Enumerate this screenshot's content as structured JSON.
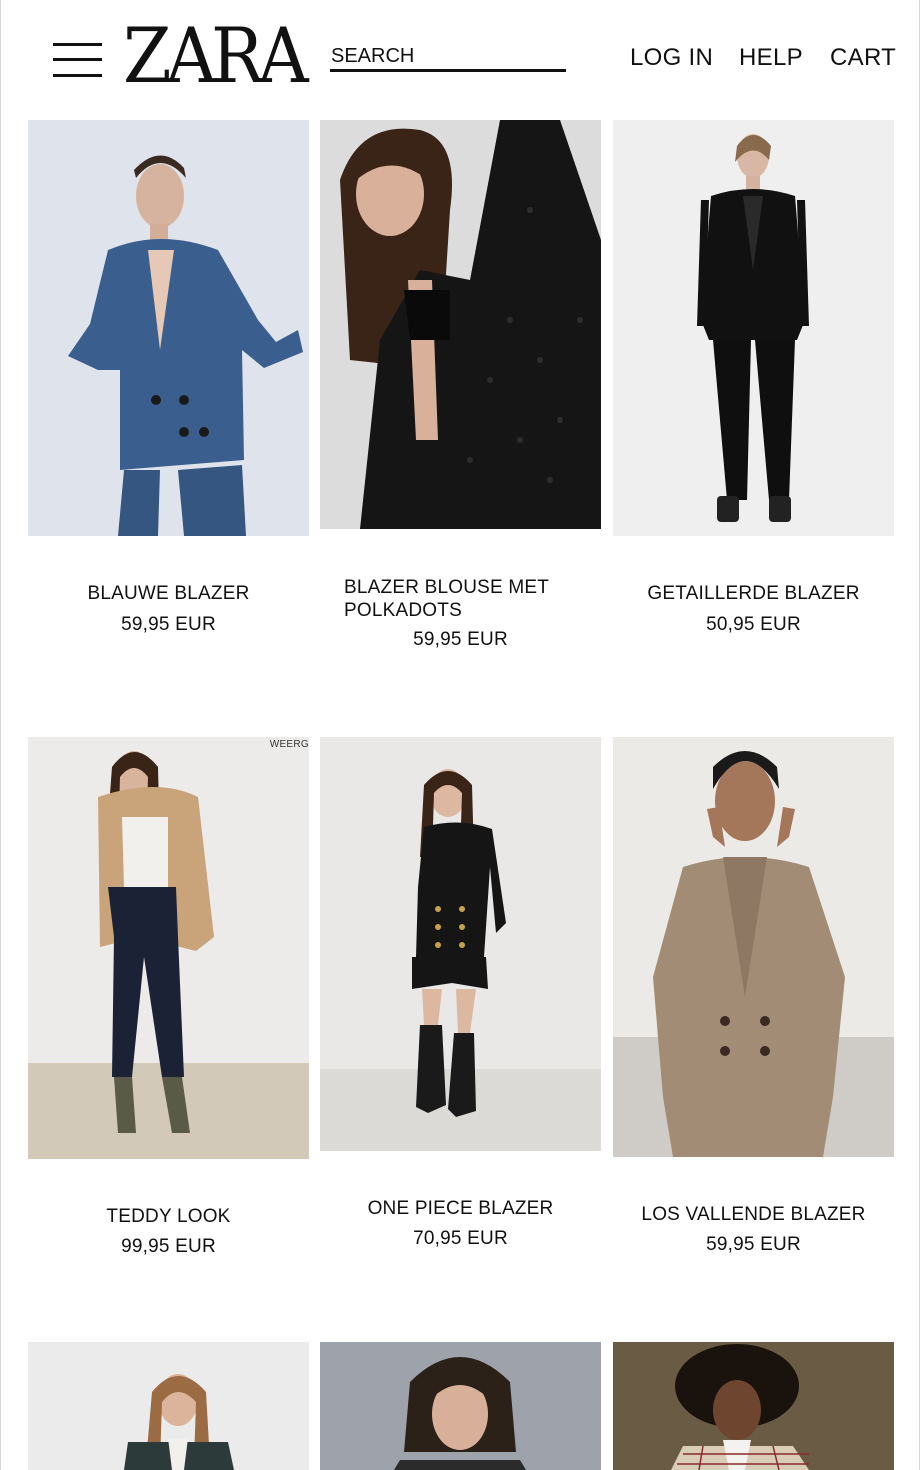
{
  "header": {
    "logo": "ZARA",
    "search_placeholder": "SEARCH",
    "nav": {
      "login": "LOG IN",
      "help": "HELP",
      "cart": "CART"
    }
  },
  "products": [
    {
      "name": "BLAUWE BLAZER",
      "price": "59,95 EUR",
      "bg": "#e4e7ef",
      "garment": "#3a5f8f"
    },
    {
      "name": "BLAZER BLOUSE MET POLKADOTS",
      "price": "59,95 EUR",
      "bg": "#dcdcdc",
      "garment": "#151515"
    },
    {
      "name": "GETAILLERDE BLAZER",
      "price": "50,95 EUR",
      "bg": "#efefef",
      "garment": "#111111"
    },
    {
      "name": "TEDDY LOOK",
      "price": "99,95 EUR",
      "bg": "#ecebea",
      "garment": "#1c2236",
      "tag": "WEERG"
    },
    {
      "name": "ONE PIECE BLAZER",
      "price": "70,95 EUR",
      "bg": "#e9e8e6",
      "garment": "#151515"
    },
    {
      "name": "LOS VALLENDE BLAZER",
      "price": "59,95 EUR",
      "bg": "#eceae6",
      "garment": "#a28c76"
    },
    {
      "name": "",
      "price": "",
      "bg": "#ecebeb",
      "garment": "#2d3a3a"
    },
    {
      "name": "",
      "price": "",
      "bg": "#9ea2ab",
      "garment": "#2b2b2b"
    },
    {
      "name": "",
      "price": "",
      "bg": "#6a5b45",
      "garment": "#d9cdb8"
    }
  ]
}
